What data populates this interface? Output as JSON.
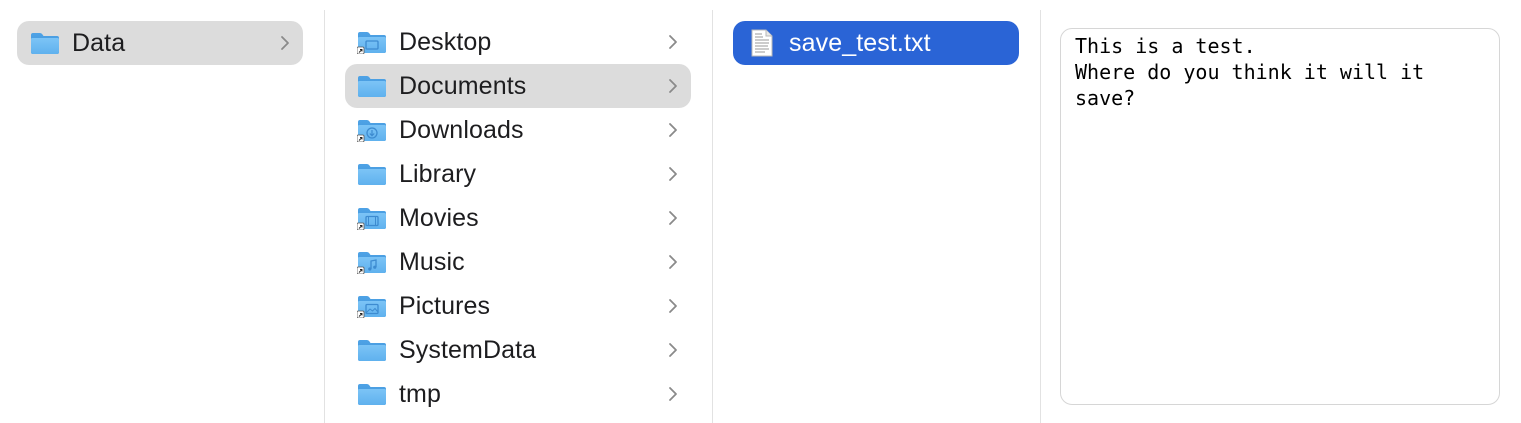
{
  "column1": {
    "items": [
      {
        "label": "Data",
        "icon": "folder-icon",
        "selected": true
      }
    ]
  },
  "column2": {
    "items": [
      {
        "label": "Desktop",
        "icon": "desktop-folder-icon"
      },
      {
        "label": "Documents",
        "icon": "folder-icon",
        "selected": true
      },
      {
        "label": "Downloads",
        "icon": "downloads-folder-icon"
      },
      {
        "label": "Library",
        "icon": "folder-icon"
      },
      {
        "label": "Movies",
        "icon": "movies-folder-icon"
      },
      {
        "label": "Music",
        "icon": "music-folder-icon"
      },
      {
        "label": "Pictures",
        "icon": "pictures-folder-icon"
      },
      {
        "label": "SystemData",
        "icon": "folder-icon"
      },
      {
        "label": "tmp",
        "icon": "folder-icon"
      }
    ]
  },
  "column3": {
    "items": [
      {
        "label": "save_test.txt",
        "icon": "text-file-icon",
        "selected": true
      }
    ]
  },
  "preview": {
    "text": "This is a test.\nWhere do you think it will it save?"
  },
  "colors": {
    "selection_blue": "#2a64d6",
    "selection_gray": "#dcdcdc",
    "folder_blue": "#64b5f2"
  }
}
